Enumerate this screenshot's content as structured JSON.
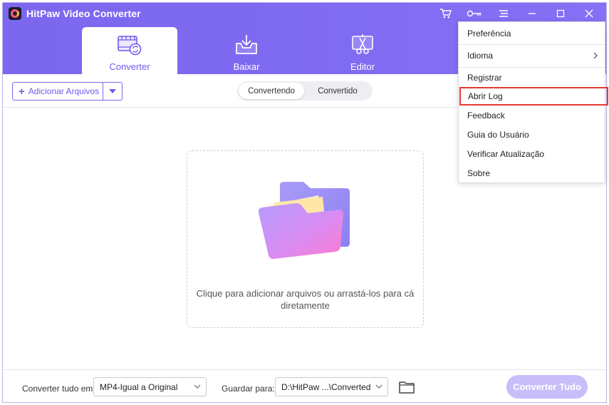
{
  "app": {
    "title": "HitPaw Video Converter"
  },
  "nav": {
    "tabs": [
      {
        "label": "Converter",
        "active": true
      },
      {
        "label": "Baixar",
        "active": false
      },
      {
        "label": "Editor",
        "active": false
      }
    ]
  },
  "toolbar": {
    "add_files_label": "Adicionar Arquivos",
    "segments": [
      {
        "label": "Convertendo",
        "active": true
      },
      {
        "label": "Convertido",
        "active": false
      }
    ]
  },
  "dropzone": {
    "text_line1": "Clique para adicionar arquivos ou arrastá-los para cá",
    "text_line2": "diretamente"
  },
  "bottom": {
    "convert_all_to_label": "Converter tudo em:",
    "format_value": "MP4-Igual a Original",
    "save_to_label": "Guardar para:",
    "path_value": "D:\\HitPaw ...\\Converted",
    "convert_all_button": "Converter Tudo"
  },
  "menu": {
    "items": [
      {
        "label": "Preferência"
      },
      {
        "label": "Idioma",
        "has_submenu": true
      },
      {
        "label": "Registrar"
      },
      {
        "label": "Abrir Log",
        "highlighted": true
      },
      {
        "label": "Feedback"
      },
      {
        "label": "Guia do Usuário"
      },
      {
        "label": "Verificar Atualização"
      },
      {
        "label": "Sobre"
      }
    ]
  },
  "colors": {
    "accent": "#7b68ee",
    "highlight_border": "#e53935",
    "convert_all_disabled": "#c9bdfa"
  }
}
